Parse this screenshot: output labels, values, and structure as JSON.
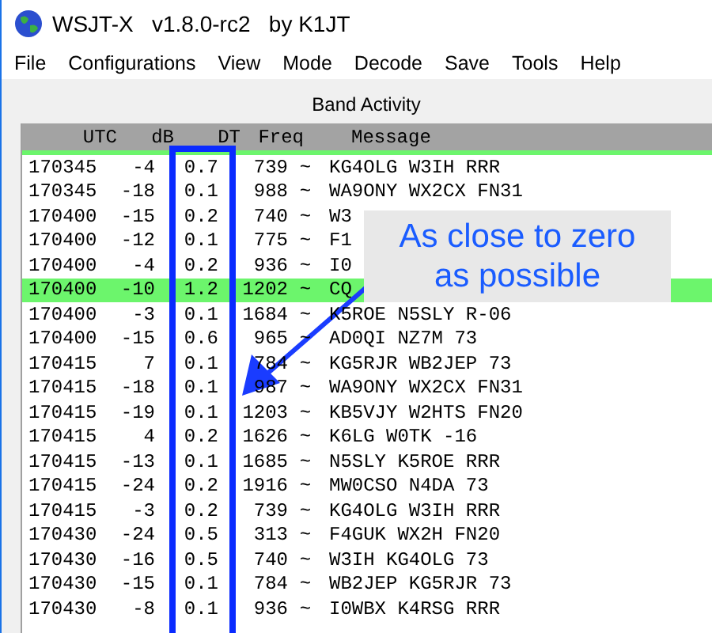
{
  "window": {
    "title": "WSJT-X   v1.8.0-rc2   by K1JT"
  },
  "menu": [
    "File",
    "Configurations",
    "View",
    "Mode",
    "Decode",
    "Save",
    "Tools",
    "Help"
  ],
  "panel": {
    "title": "Band Activity"
  },
  "table": {
    "columns": [
      "UTC",
      "dB",
      "DT",
      "Freq",
      "Message"
    ],
    "rows": [
      {
        "utc": "170345",
        "db": "-4",
        "dt": "0.7",
        "freq": "739",
        "sep": "~",
        "message": "KG4OLG W3IH RRR",
        "selected": false
      },
      {
        "utc": "170345",
        "db": "-18",
        "dt": "0.1",
        "freq": "988",
        "sep": "~",
        "message": "WA9ONY WX2CX FN31",
        "selected": false
      },
      {
        "utc": "170400",
        "db": "-15",
        "dt": "0.2",
        "freq": "740",
        "sep": "~",
        "message": "W3",
        "selected": false
      },
      {
        "utc": "170400",
        "db": "-12",
        "dt": "0.1",
        "freq": "775",
        "sep": "~",
        "message": "F1",
        "selected": false
      },
      {
        "utc": "170400",
        "db": "-4",
        "dt": "0.2",
        "freq": "936",
        "sep": "~",
        "message": "I0",
        "selected": false
      },
      {
        "utc": "170400",
        "db": "-10",
        "dt": "1.2",
        "freq": "1202",
        "sep": "~",
        "message": "CQ",
        "selected": true
      },
      {
        "utc": "170400",
        "db": "-3",
        "dt": "0.1",
        "freq": "1684",
        "sep": "~",
        "message": "K5ROE N5SLY R-06",
        "selected": false
      },
      {
        "utc": "170400",
        "db": "-15",
        "dt": "0.6",
        "freq": "965",
        "sep": "~",
        "message": "AD0QI NZ7M 73",
        "selected": false
      },
      {
        "utc": "170415",
        "db": "7",
        "dt": "0.1",
        "freq": "784",
        "sep": "~",
        "message": "KG5RJR WB2JEP 73",
        "selected": false
      },
      {
        "utc": "170415",
        "db": "-18",
        "dt": "0.1",
        "freq": "987",
        "sep": "~",
        "message": "WA9ONY WX2CX FN31",
        "selected": false
      },
      {
        "utc": "170415",
        "db": "-19",
        "dt": "0.1",
        "freq": "1203",
        "sep": "~",
        "message": "KB5VJY W2HTS FN20",
        "selected": false
      },
      {
        "utc": "170415",
        "db": "4",
        "dt": "0.2",
        "freq": "1626",
        "sep": "~",
        "message": "K6LG W0TK -16",
        "selected": false
      },
      {
        "utc": "170415",
        "db": "-13",
        "dt": "0.1",
        "freq": "1685",
        "sep": "~",
        "message": "N5SLY K5ROE RRR",
        "selected": false
      },
      {
        "utc": "170415",
        "db": "-24",
        "dt": "0.2",
        "freq": "1916",
        "sep": "~",
        "message": "MW0CSO N4DA 73",
        "selected": false
      },
      {
        "utc": "170415",
        "db": "-3",
        "dt": "0.2",
        "freq": "739",
        "sep": "~",
        "message": "KG4OLG W3IH RRR",
        "selected": false
      },
      {
        "utc": "170430",
        "db": "-24",
        "dt": "0.5",
        "freq": "313",
        "sep": "~",
        "message": "F4GUK WX2H FN20",
        "selected": false
      },
      {
        "utc": "170430",
        "db": "-16",
        "dt": "0.5",
        "freq": "740",
        "sep": "~",
        "message": "W3IH KG4OLG 73",
        "selected": false
      },
      {
        "utc": "170430",
        "db": "-15",
        "dt": "0.1",
        "freq": "784",
        "sep": "~",
        "message": "WB2JEP KG5RJR 73",
        "selected": false
      },
      {
        "utc": "170430",
        "db": "-8",
        "dt": "0.1",
        "freq": "936",
        "sep": "~",
        "message": "I0WBX K4RSG RRR",
        "selected": false
      }
    ]
  },
  "callout": {
    "text": "As close to zero as possible"
  }
}
